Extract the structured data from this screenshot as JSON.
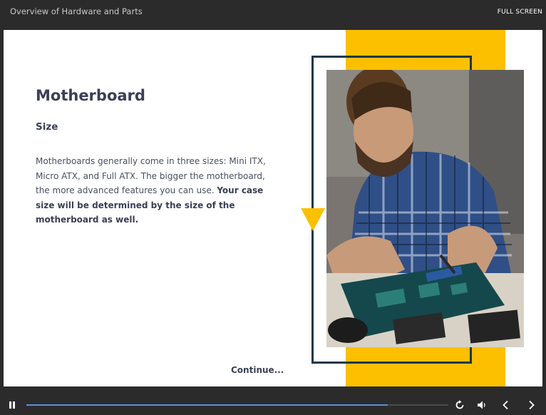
{
  "window": {
    "title": "Overview of Hardware and Parts",
    "fullscreen_label": "FULL SCREEN"
  },
  "slide": {
    "title": "Motherboard",
    "subtitle": "Size",
    "body_plain": "Motherboards generally come in three sizes: Mini ITX, Micro ATX, and Full ATX. The bigger the motherboard, the more advanced features you can use. ",
    "body_bold": "Your case size will be determined by the size of the motherboard as well.",
    "continue_label": "Continue...",
    "image_alt": "Technician soldering a circuit board"
  },
  "player": {
    "progress_fraction": 0.857,
    "icons": [
      "pause-icon",
      "replay-icon",
      "volume-icon",
      "previous-icon",
      "next-icon"
    ]
  },
  "colors": {
    "accent_yellow": "#fcc000",
    "frame_navy": "#163849",
    "title_text": "#3a3f55",
    "progress_blue": "#5b8fd8",
    "chrome_bg": "#2b2b2b"
  }
}
